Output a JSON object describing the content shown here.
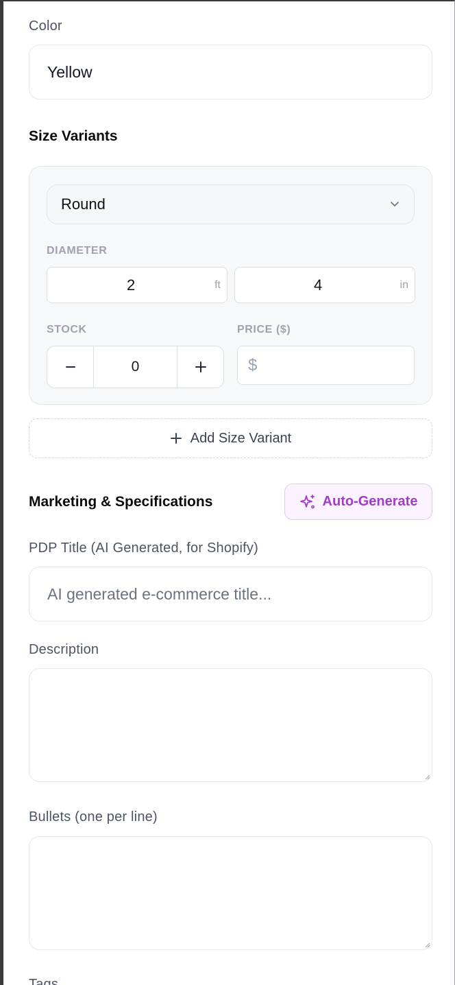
{
  "color_field": {
    "label": "Color",
    "value": "Yellow"
  },
  "size_variants": {
    "title": "Size Variants",
    "shape_select": {
      "value": "Round"
    },
    "diameter_label": "DIAMETER",
    "diameter_feet": {
      "value": "2",
      "unit": "ft"
    },
    "diameter_inches": {
      "value": "4",
      "unit": "in"
    },
    "stock_label": "STOCK",
    "stock": {
      "decrement": "−",
      "value": "0",
      "increment": "+"
    },
    "price_label": "PRICE ($)",
    "price": {
      "prefix": "$",
      "value": ""
    },
    "add_variant_label": "Add Size Variant"
  },
  "marketing": {
    "title": "Marketing & Specifications",
    "auto_generate_label": "Auto-Generate",
    "pdp_title_label": "PDP Title (AI Generated, for Shopify)",
    "pdp_title_placeholder": "AI generated e-commerce title...",
    "description_label": "Description",
    "bullets_label": "Bullets (one per line)",
    "tags_label": "Tags"
  },
  "icons": {
    "chevron": "chevron-down-icon",
    "plus": "plus-icon",
    "sparkles": "sparkles-icon"
  },
  "colors": {
    "accent_purple": "#a23cc9",
    "accent_purple_bg": "#fbf3ff",
    "border": "#e5e7eb",
    "muted_text": "#9ca3af"
  }
}
